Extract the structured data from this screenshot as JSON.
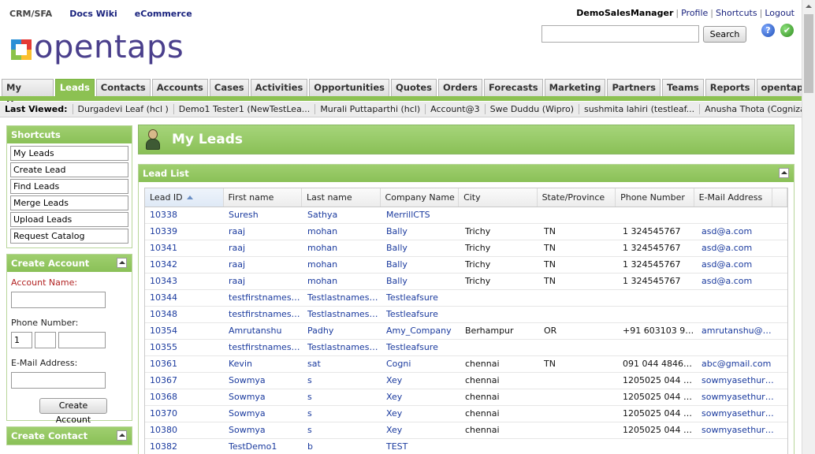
{
  "top_nav": [
    "CRM/SFA",
    "Docs Wiki",
    "eCommerce"
  ],
  "logo_text": "opentaps",
  "user": {
    "name": "DemoSalesManager",
    "links": [
      "Profile",
      "Shortcuts",
      "Logout"
    ]
  },
  "search": {
    "value": "",
    "button": "Search"
  },
  "icons": {
    "help": "help-icon",
    "status": "checkmark-icon"
  },
  "tabs": [
    "My Home",
    "Leads",
    "Contacts",
    "Accounts",
    "Cases",
    "Activities",
    "Opportunities",
    "Quotes",
    "Orders",
    "Forecasts",
    "Marketing",
    "Partners",
    "Teams",
    "Reports",
    "opentaps"
  ],
  "active_tab": "Leads",
  "last_viewed": {
    "label": "Last Viewed:",
    "items": [
      "Durgadevi Leaf (hcl )",
      "Demo1 Tester1 (NewTestLea...",
      "Murali Puttaparthi (hcl)",
      "Account@3",
      "Swe Duddu (Wipro)",
      "sushmita lahiri (testleaf...",
      "Anusha Thota (Cognizant)"
    ]
  },
  "shortcuts": {
    "title": "Shortcuts",
    "items": [
      "My Leads",
      "Create Lead",
      "Find Leads",
      "Merge Leads",
      "Upload Leads",
      "Request Catalog"
    ]
  },
  "create_account": {
    "title": "Create Account",
    "account_name_label": "Account Name:",
    "phone_label": "Phone Number:",
    "phone_country_code": "1",
    "email_label": "E-Mail Address:",
    "button": "Create Account"
  },
  "create_contact": {
    "title": "Create Contact"
  },
  "page_title": "My Leads",
  "lead_list": {
    "title": "Lead List",
    "columns": [
      "Lead ID",
      "First name",
      "Last name",
      "Company Name",
      "City",
      "State/Province",
      "Phone Number",
      "E-Mail Address"
    ],
    "rows": [
      [
        "10338",
        "Suresh",
        "Sathya",
        "MerrillCTS",
        "",
        "",
        "",
        ""
      ],
      [
        "10339",
        "raaj",
        "mohan",
        "Bally",
        "Trichy",
        "TN",
        "1 324545767",
        "asd@a.com"
      ],
      [
        "10341",
        "raaj",
        "mohan",
        "Bally",
        "Trichy",
        "TN",
        "1 324545767",
        "asd@a.com"
      ],
      [
        "10342",
        "raaj",
        "mohan",
        "Bally",
        "Trichy",
        "TN",
        "1 324545767",
        "asd@a.com"
      ],
      [
        "10343",
        "raaj",
        "mohan",
        "Bally",
        "Trichy",
        "TN",
        "1 324545767",
        "asd@a.com"
      ],
      [
        "10344",
        "testfirstnamesure",
        "Testlastnamesure",
        "Testleafsure",
        "",
        "",
        "",
        ""
      ],
      [
        "10348",
        "testfirstnamesure",
        "Testlastnamesure",
        "Testleafsure",
        "",
        "",
        "",
        ""
      ],
      [
        "10354",
        "Amrutanshu",
        "Padhy",
        "Amy_Company",
        "Berhampur",
        "OR",
        "+91 603103 99...",
        "amrutanshu@g..."
      ],
      [
        "10355",
        "testfirstnamesure",
        "Testlastnamesure",
        "Testleafsure",
        "",
        "",
        "",
        ""
      ],
      [
        "10361",
        "Kevin",
        "sat",
        "Cogni",
        "chennai",
        "TN",
        "091 044 48465...",
        "abc@gmail.com"
      ],
      [
        "10367",
        "Sowmya",
        "s",
        "Xey",
        "chennai",
        "",
        "1205025 044 3...",
        "sowmyasethura..."
      ],
      [
        "10368",
        "Sowmya",
        "s",
        "Xey",
        "chennai",
        "",
        "1205025 044 3...",
        "sowmyasethura..."
      ],
      [
        "10370",
        "Sowmya",
        "s",
        "Xey",
        "chennai",
        "",
        "1205025 044 3...",
        "sowmyasethura..."
      ],
      [
        "10380",
        "Sowmya",
        "s",
        "Xey",
        "chennai",
        "",
        "1205025 044 3...",
        "sowmyasethura..."
      ],
      [
        "10382",
        "TestDemo1",
        "b",
        "TEST",
        "",
        "",
        "",
        ""
      ]
    ]
  }
}
